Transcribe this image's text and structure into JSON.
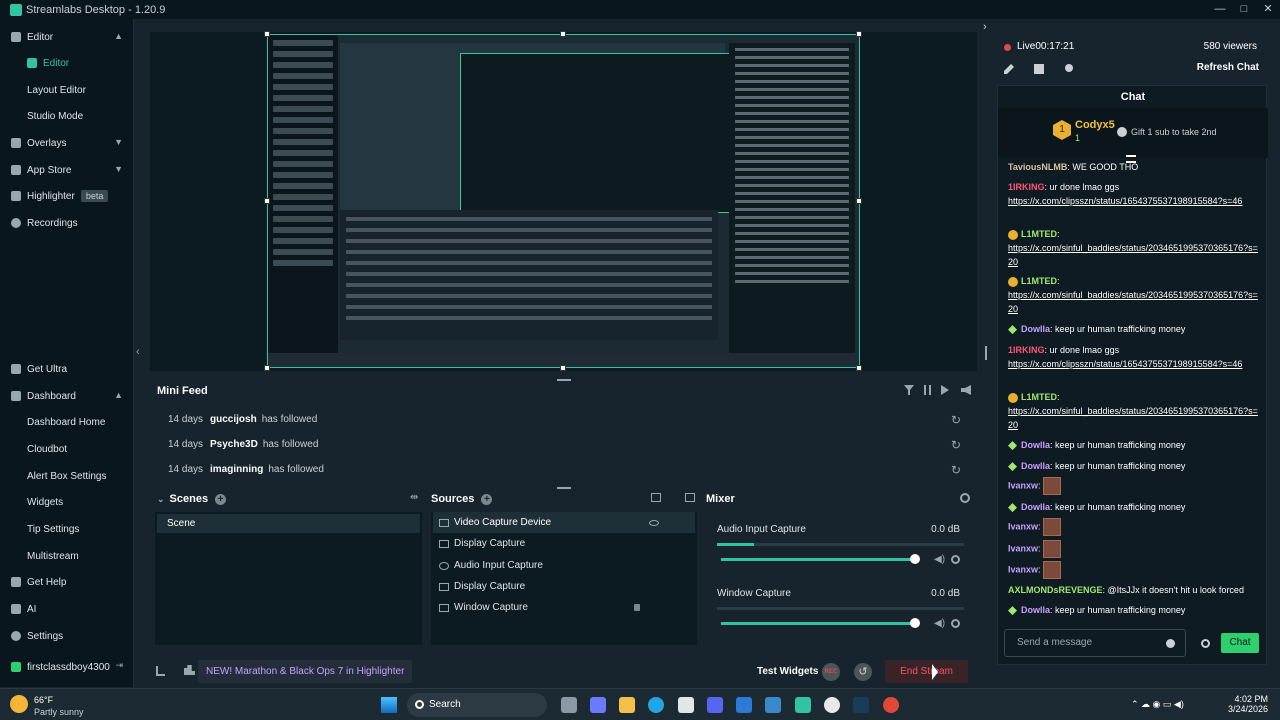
{
  "window": {
    "title": "Streamlabs Desktop - 1.20.9",
    "buttons": [
      "—",
      "□",
      "✕"
    ]
  },
  "sidebar": {
    "items": [
      {
        "label": "Editor",
        "icon": "editor-icon"
      },
      {
        "label": "Editor",
        "icon": ""
      },
      {
        "label": "Layout Editor",
        "icon": ""
      },
      {
        "label": "Studio Mode",
        "icon": ""
      },
      {
        "label": "Overlays",
        "icon": "overlays-icon"
      },
      {
        "label": "App Store",
        "icon": "app-store-icon"
      },
      {
        "label": "Highlighter",
        "icon": "highlighter-icon",
        "badge": "beta"
      },
      {
        "label": "Recordings",
        "icon": "recordings-icon"
      }
    ],
    "bottom": [
      {
        "label": "Get Ultra"
      },
      {
        "label": "Dashboard"
      },
      {
        "label": "Dashboard Home"
      },
      {
        "label": "Cloudbot"
      },
      {
        "label": "Alert Box Settings"
      },
      {
        "label": "Widgets"
      },
      {
        "label": "Tip Settings"
      },
      {
        "label": "Multistream"
      },
      {
        "label": "Get Help"
      },
      {
        "label": "AI"
      },
      {
        "label": "Settings"
      },
      {
        "label": "firstclassdboy4300"
      }
    ]
  },
  "minifeed": {
    "title": "Mini Feed",
    "rows": [
      {
        "age": "14 days",
        "user": "guccijosh",
        "action": "has followed"
      },
      {
        "age": "14 days",
        "user": "Psyche3D",
        "action": "has followed"
      },
      {
        "age": "14 days",
        "user": "imaginning",
        "action": "has followed"
      }
    ]
  },
  "scenes": {
    "title": "Scenes",
    "items": [
      "Scene"
    ]
  },
  "sources": {
    "title": "Sources",
    "items": [
      "Video Capture Device",
      "Display Capture",
      "Audio Input Capture",
      "Display Capture",
      "Window Capture"
    ]
  },
  "mixer": {
    "title": "Mixer",
    "items": [
      {
        "name": "Audio Input Capture",
        "db": "0.0 dB",
        "level": 0.15
      },
      {
        "name": "Window Capture",
        "db": "0.0 dB",
        "level": 0
      }
    ]
  },
  "footer": {
    "notification": "NEW! Marathon & Black Ops 7 in Highlighter",
    "test_widgets": "Test Widgets",
    "rec": "REC",
    "end_stream": "End Stream"
  },
  "stream": {
    "live": "Live",
    "timer": "00:17:21",
    "viewers": "580 viewers",
    "refresh": "Refresh Chat"
  },
  "chat": {
    "title": "Chat",
    "pinned": {
      "name": "Codyx5",
      "badge": "1",
      "subline": "1",
      "gift": "Gift 1 sub to take 2nd"
    },
    "messages": [
      {
        "user": "TaviousNLMB",
        "text": "WE GOOD THO",
        "color": "#d9c0a0"
      },
      {
        "user": "1IRKING",
        "text": "ur done lmao ggs",
        "color": "#ff5574",
        "link": "https://x.com/clipsszn/status/1654375537198915584?s=46"
      },
      {
        "user": "L1MTED",
        "text": "",
        "color": "#9fe870",
        "link": "https://x.com/sinful_baddies/status/2034651995370365176?s=20"
      },
      {
        "user": "L1MTED",
        "text": "",
        "color": "#9fe870",
        "link": "https://x.com/sinful_baddies/status/2034651995370365176?s=20"
      },
      {
        "user": "Dowlla",
        "text": "keep ur human trafficking money",
        "color": "#c9a0ff"
      },
      {
        "user": "1IRKING",
        "text": "ur done lmao ggs",
        "color": "#ff5574",
        "link": "https://x.com/clipsszn/status/1654375537198915584?s=46"
      },
      {
        "user": "L1MTED",
        "text": "",
        "color": "#9fe870",
        "link": "https://x.com/sinful_baddies/status/2034651995370365176?s=20"
      },
      {
        "user": "Dowlla",
        "text": "keep ur human trafficking money",
        "color": "#c9a0ff"
      },
      {
        "user": "Dowlla",
        "text": "keep ur human trafficking money",
        "color": "#c9a0ff"
      },
      {
        "user": "Ivanxw",
        "text": "",
        "color": "#c9a0ff"
      },
      {
        "user": "Dowlla",
        "text": "keep ur human trafficking money",
        "color": "#c9a0ff"
      },
      {
        "user": "Ivanxw",
        "text": "",
        "color": "#c9a0ff"
      },
      {
        "user": "Ivanxw",
        "text": "",
        "color": "#c9a0ff"
      },
      {
        "user": "Ivanxw",
        "text": "",
        "color": "#c9a0ff"
      },
      {
        "user": "AXLMONDsREVENGE",
        "text": "@ItsJJx it doesn't hit u look forced",
        "color": "#9fe870"
      },
      {
        "user": "Dowlla",
        "text": "keep ur human trafficking money",
        "color": "#c9a0ff"
      }
    ],
    "input_placeholder": "Send a message",
    "send": "Chat"
  },
  "taskbar": {
    "temp": "66°F",
    "condition": "Partly sunny",
    "search": "Search",
    "time": "4:02 PM",
    "date": "3/24/2026"
  },
  "colors": {
    "accent": "#31c3a2",
    "danger": "#f2556b",
    "chat_button": "#2ed06e"
  }
}
